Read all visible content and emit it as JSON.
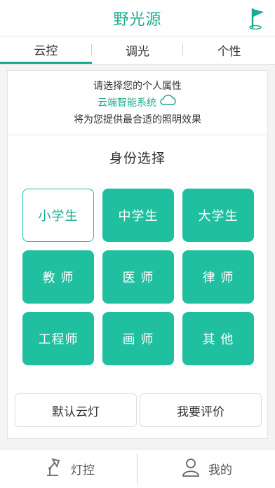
{
  "header": {
    "title": "野光源",
    "flag_icon": "flag-icon"
  },
  "tabs": [
    {
      "label": "云控",
      "active": true
    },
    {
      "label": "调光",
      "active": false
    },
    {
      "label": "个性",
      "active": false
    }
  ],
  "intro": {
    "line1": "请选择您的个人属性",
    "line2": "云端智能系统",
    "line2_icon": "cloud-icon",
    "line3": "将为您提供最合适的照明效果"
  },
  "identity": {
    "title": "身份选择",
    "options": [
      {
        "label": "小学生",
        "selected": true
      },
      {
        "label": "中学生",
        "selected": false
      },
      {
        "label": "大学生",
        "selected": false
      },
      {
        "label": "教 师",
        "selected": false
      },
      {
        "label": "医 师",
        "selected": false
      },
      {
        "label": "律 师",
        "selected": false
      },
      {
        "label": "工程师",
        "selected": false
      },
      {
        "label": "画 师",
        "selected": false
      },
      {
        "label": "其 他",
        "selected": false
      }
    ]
  },
  "actions": {
    "default_label": "默认云灯",
    "review_label": "我要评价"
  },
  "bottom_nav": [
    {
      "label": "灯控",
      "icon": "desk-lamp-icon"
    },
    {
      "label": "我的",
      "icon": "user-icon"
    }
  ],
  "colors": {
    "accent": "#1fbfa0",
    "accent_text": "#1aaa8e"
  }
}
